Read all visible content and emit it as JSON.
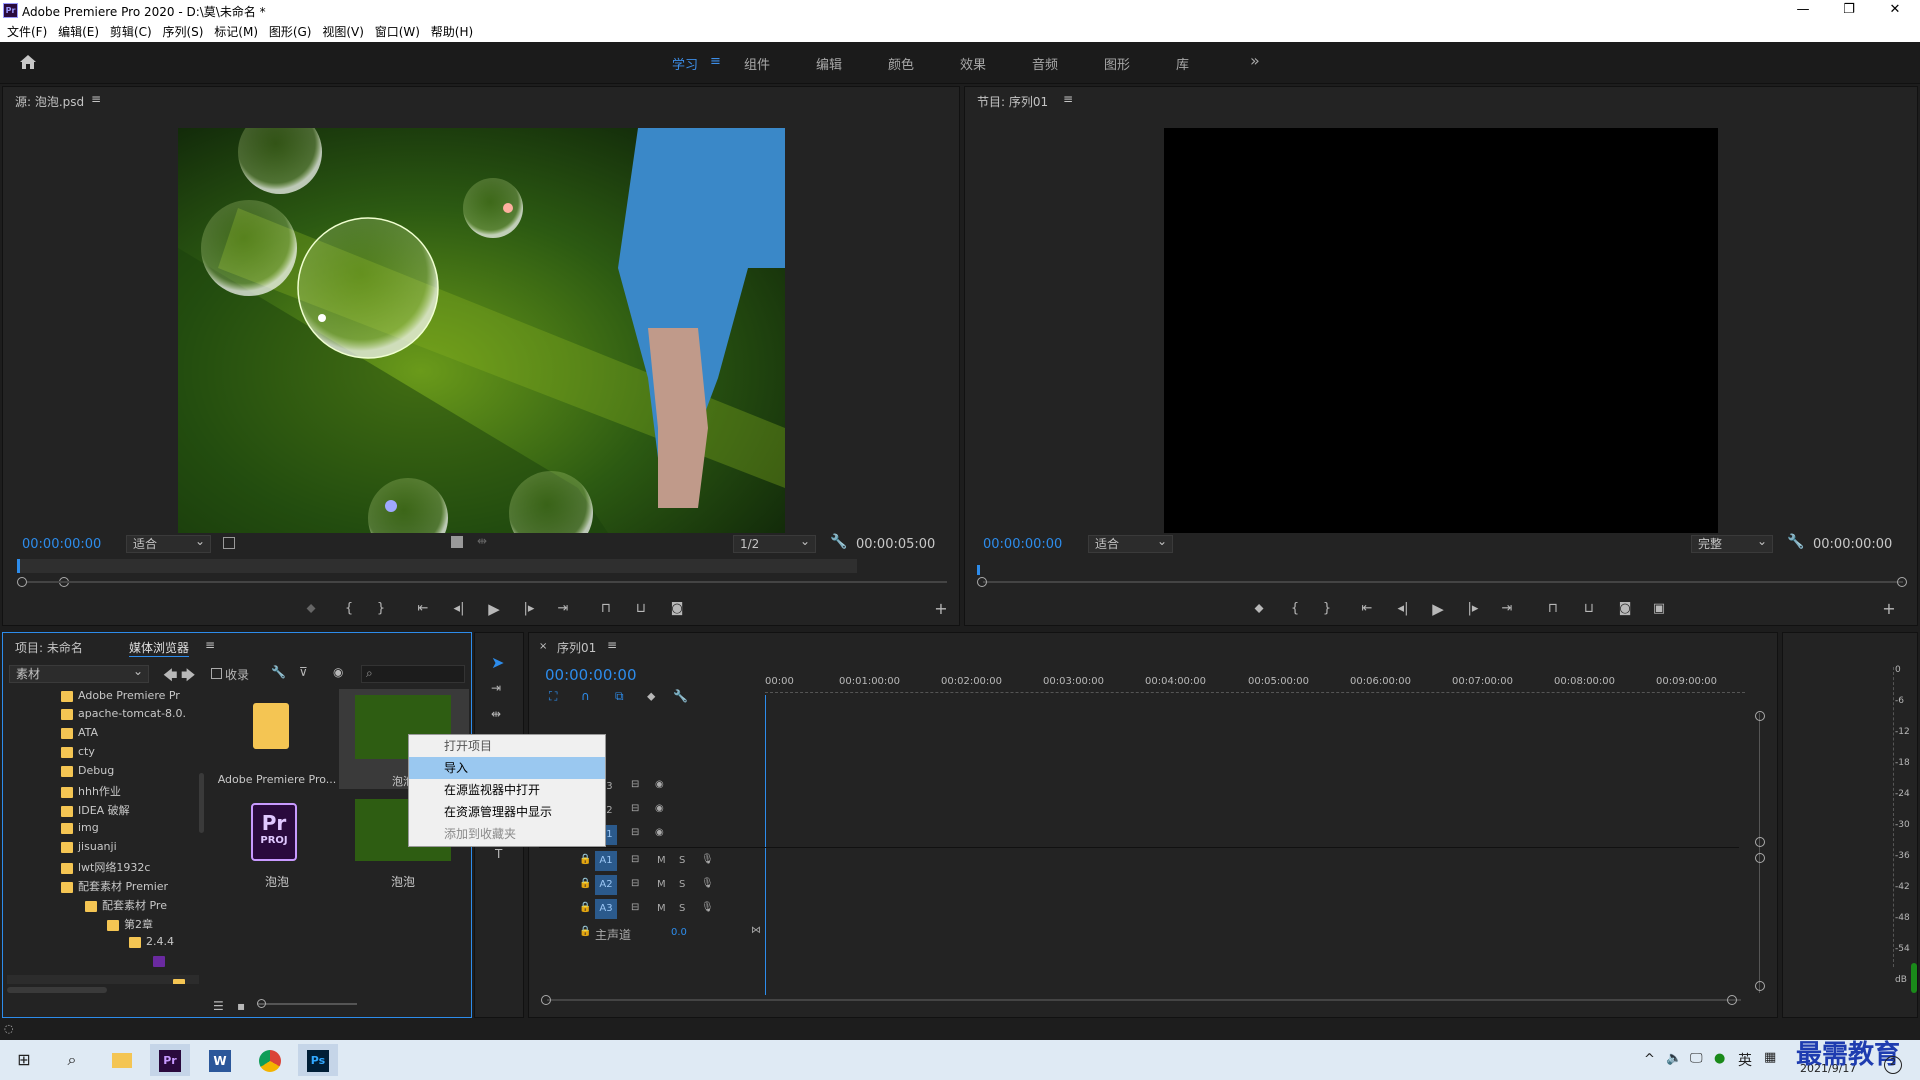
{
  "window": {
    "title": "Adobe Premiere Pro 2020 - D:\\莫\\未命名 *",
    "app_icon": "Pr",
    "controls": [
      "minimize-icon",
      "restore-icon",
      "close-icon"
    ]
  },
  "menu": [
    "文件(F)",
    "编辑(E)",
    "剪辑(C)",
    "序列(S)",
    "标记(M)",
    "图形(G)",
    "视图(V)",
    "窗口(W)",
    "帮助(H)"
  ],
  "workspaces": {
    "items": [
      "学习",
      "组件",
      "编辑",
      "颜色",
      "效果",
      "音频",
      "图形",
      "库"
    ],
    "active": "学习",
    "more": "»"
  },
  "source_monitor": {
    "title": "源: 泡泡.psd",
    "timecode_in": "00:00:00:00",
    "fit": "适合",
    "resolution": "1/2",
    "duration": "00:00:05:00"
  },
  "program_monitor": {
    "title": "节目: 序列01",
    "timecode_in": "00:00:00:00",
    "fit": "适合",
    "quality": "完整",
    "timecode_out": "00:00:00:00"
  },
  "project_panel": {
    "tab_project": "项目: 未命名",
    "tab_media": "媒体浏览器",
    "source_dropdown": "素材",
    "favorites_label": "收录",
    "tree": [
      {
        "label": "Adobe Premiere Pr",
        "indent": 0
      },
      {
        "label": "apache-tomcat-8.0.",
        "indent": 0
      },
      {
        "label": "ATA",
        "indent": 0
      },
      {
        "label": "cty",
        "indent": 0
      },
      {
        "label": "Debug",
        "indent": 0
      },
      {
        "label": "hhh作业",
        "indent": 0
      },
      {
        "label": "IDEA 破解",
        "indent": 0
      },
      {
        "label": "img",
        "indent": 0
      },
      {
        "label": "jisuanji",
        "indent": 0
      },
      {
        "label": "lwt网络1932c",
        "indent": 0
      },
      {
        "label": "配套素材 Premier",
        "indent": 0
      },
      {
        "label": "配套素材 Pre",
        "indent": 1
      },
      {
        "label": "第2章",
        "indent": 2
      },
      {
        "label": "2.4.4",
        "indent": 3
      }
    ],
    "thumbs": [
      {
        "label": "Adobe Premiere Pro...",
        "type": "folder"
      },
      {
        "label": "泡泡",
        "type": "image"
      },
      {
        "label": "泡泡",
        "type": "proj"
      },
      {
        "label": "泡泡",
        "type": "image"
      }
    ]
  },
  "context_menu": {
    "items": [
      {
        "label": "打开项目",
        "state": "normal"
      },
      {
        "label": "导入",
        "state": "highlighted"
      },
      {
        "label": "在源监视器中打开",
        "state": "normal"
      },
      {
        "label": "在资源管理器中显示",
        "state": "normal"
      },
      {
        "label": "添加到收藏夹",
        "state": "disabled"
      }
    ]
  },
  "timeline": {
    "tab": "序列01",
    "timecode": "00:00:00:00",
    "ruler": [
      "00:00",
      "00:01:00:00",
      "00:02:00:00",
      "00:03:00:00",
      "00:04:00:00",
      "00:05:00:00",
      "00:06:00:00",
      "00:07:00:00",
      "00:08:00:00",
      "00:09:00:00"
    ],
    "video_tracks": [
      "V3",
      "V2",
      "V1"
    ],
    "audio_tracks": [
      "A1",
      "A2",
      "A3"
    ],
    "mute_label": "M",
    "solo_label": "S",
    "master_label": "主声道",
    "master_value": "0.0"
  },
  "audio_meter": {
    "scale": [
      "0",
      "-6",
      "-12",
      "-18",
      "-24",
      "-30",
      "-36",
      "-42",
      "-48",
      "-54",
      "dB"
    ]
  },
  "taskbar": {
    "ime": "英",
    "date": "2021/9/17",
    "watermark": "最需教育"
  },
  "colors": {
    "accent": "#2d8ceb",
    "panel": "#232323",
    "highlight": "#9ac8f0"
  }
}
